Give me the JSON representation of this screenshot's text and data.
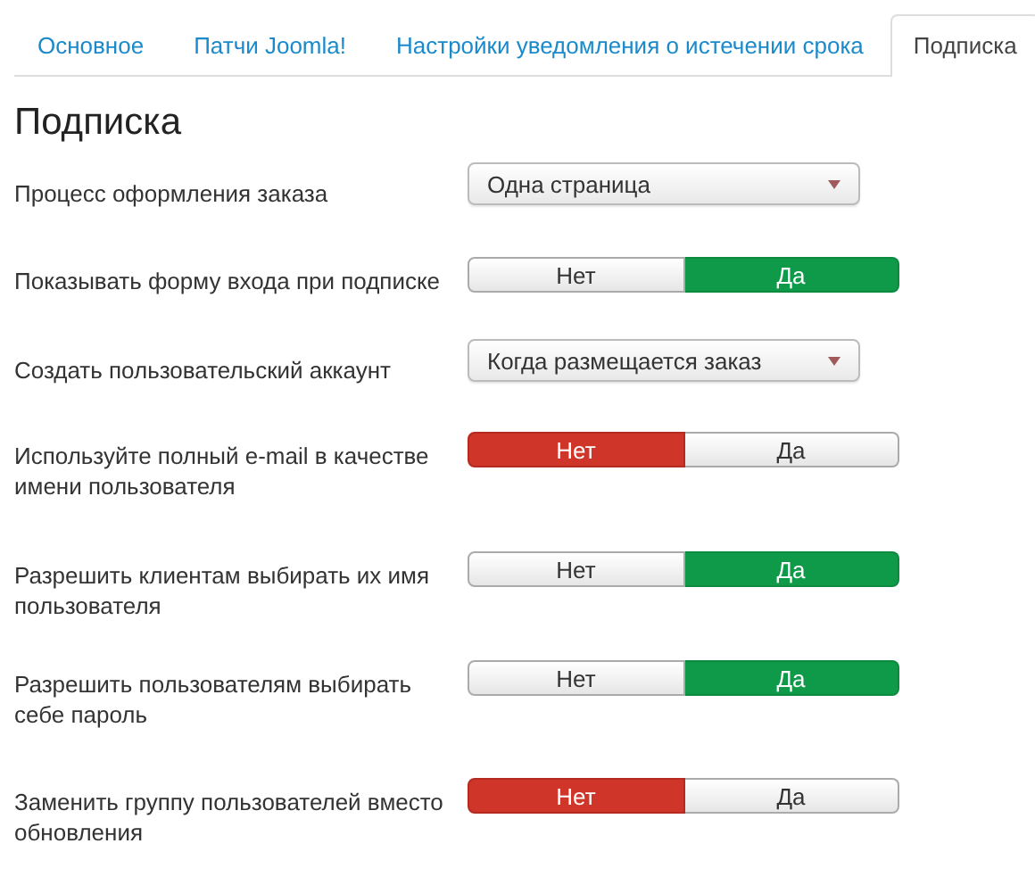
{
  "tabs": [
    {
      "label": "Основное",
      "selected": false
    },
    {
      "label": "Патчи Joomla!",
      "selected": false
    },
    {
      "label": "Настройки уведомления о истечении срока",
      "selected": false
    },
    {
      "label": "Подписка",
      "selected": true
    }
  ],
  "heading": "Подписка",
  "fields": [
    {
      "label": "Процесс оформления заказа",
      "kind": "select",
      "value": "Одна страница"
    },
    {
      "label": "Показывать форму входа при подписке",
      "kind": "toggle",
      "options": [
        {
          "label": "Нет",
          "kind": "negative",
          "selected": false
        },
        {
          "label": "Да",
          "kind": "positive",
          "selected": true
        }
      ]
    },
    {
      "label": "Создать пользовательский аккаунт",
      "kind": "select",
      "value": "Когда размещается заказ"
    },
    {
      "label": "Используйте полный e-mail в качестве имени пользователя",
      "kind": "toggle",
      "options": [
        {
          "label": "Нет",
          "kind": "negative",
          "selected": true
        },
        {
          "label": "Да",
          "kind": "positive",
          "selected": false
        }
      ]
    },
    {
      "label": "Разрешить клиентам выбирать их имя пользователя",
      "kind": "toggle",
      "options": [
        {
          "label": "Нет",
          "kind": "negative",
          "selected": false
        },
        {
          "label": "Да",
          "kind": "positive",
          "selected": true
        }
      ]
    },
    {
      "label": "Разрешить пользователям выбирать себе пароль",
      "kind": "toggle",
      "options": [
        {
          "label": "Нет",
          "kind": "negative",
          "selected": false
        },
        {
          "label": "Да",
          "kind": "positive",
          "selected": true
        }
      ]
    },
    {
      "label": "Заменить группу пользователей вместо обновления",
      "kind": "toggle",
      "options": [
        {
          "label": "Нет",
          "kind": "negative",
          "selected": true
        },
        {
          "label": "Да",
          "kind": "positive",
          "selected": false
        }
      ]
    }
  ]
}
